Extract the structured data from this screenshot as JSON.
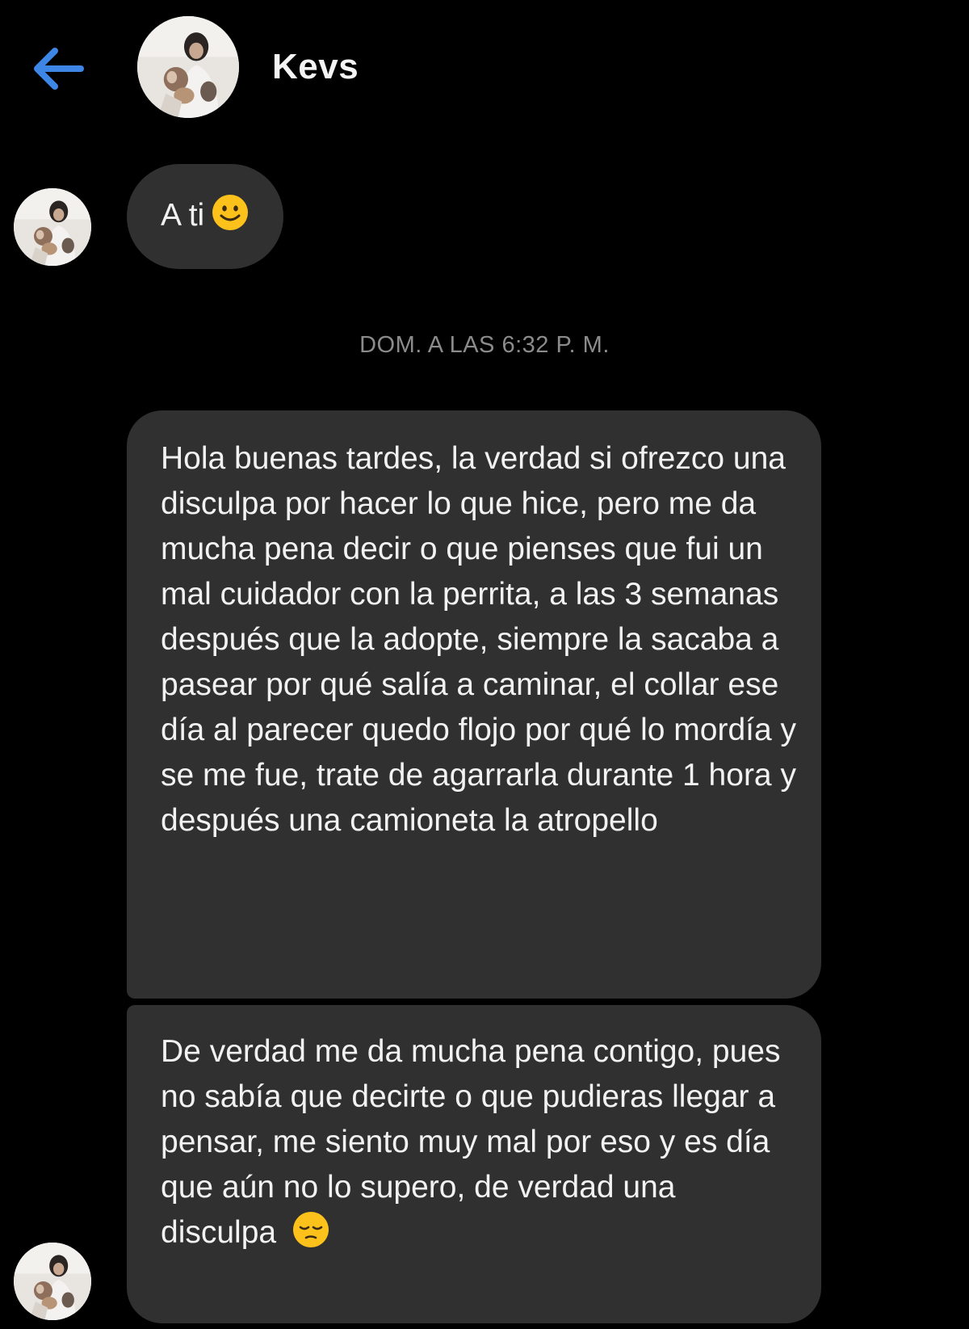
{
  "header": {
    "back_icon": "arrow-left-icon",
    "contact_name": "Kevs",
    "accent_color": "#3d86e6"
  },
  "messages": [
    {
      "text": "A ti",
      "emoji": "smiling-face-icon"
    },
    {
      "timestamp": "DOM. A LAS 6:32 P. M."
    },
    {
      "text": "Hola buenas tardes, la verdad si ofrezco una disculpa por hacer lo que hice, pero me da mucha pena decir o que pienses que fui un mal cuidador con la perrita, a las 3 semanas después que la adopte, siempre la sacaba a pasear por qué salía a caminar, el collar ese día al parecer quedo flojo por qué lo mordía y se me fue, trate de agarrarla durante 1 hora y después una camioneta la atropello"
    },
    {
      "text": "De verdad me da mucha pena contigo, pues no sabía que decirte o que pudieras llegar a pensar, me siento muy mal por eso y es día que aún no lo supero, de verdad una disculpa",
      "emoji": "pensive-face-icon"
    }
  ],
  "colors": {
    "background": "#000000",
    "bubble": "#303030",
    "timestamp": "#8b8b8b"
  }
}
